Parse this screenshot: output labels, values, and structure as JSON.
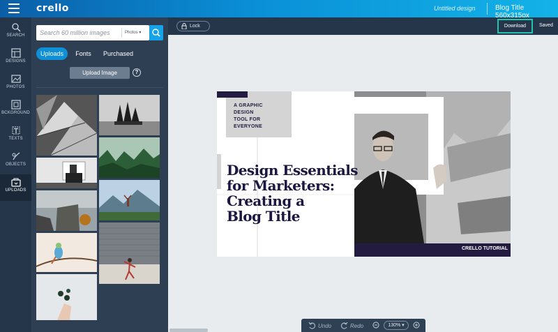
{
  "app": {
    "logo": "crello",
    "doc_title": "Untitled design",
    "format": "Blog Title 560x315px"
  },
  "rail": {
    "items": [
      {
        "label": "SEARCH",
        "icon": "search-icon"
      },
      {
        "label": "DESIGNS",
        "icon": "layout-icon"
      },
      {
        "label": "PHOTOS",
        "icon": "photo-icon"
      },
      {
        "label": "BCKGROUND",
        "icon": "background-icon"
      },
      {
        "label": "TEXTS",
        "icon": "text-icon"
      },
      {
        "label": "OBJECTS",
        "icon": "objects-icon"
      },
      {
        "label": "UPLOADS",
        "icon": "uploads-icon",
        "active": true
      }
    ]
  },
  "panel": {
    "search_placeholder": "Search 60 million images",
    "filter": "Photos",
    "tabs": [
      "Uploads",
      "Fonts",
      "Purchased"
    ],
    "active_tab": "Uploads",
    "upload_label": "Upload Image",
    "help": "?"
  },
  "toolbar": {
    "lock": "Lock",
    "download": "Download",
    "saved": "Saved"
  },
  "design": {
    "tagline": [
      "A GRAPHIC",
      "DESIGN",
      "TOOL FOR",
      "EVERYONE"
    ],
    "headline": [
      "Design Essentials",
      "for Marketers:",
      "Creating a",
      "Blog Title"
    ],
    "badge": "CRELLO TUTORIAL"
  },
  "zoom": {
    "undo": "Undo",
    "redo": "Redo",
    "level": "130%"
  },
  "colors": {
    "accent": "#17a3e8",
    "download_border": "#20c4b0",
    "rail_bg": "#25364a",
    "panel_bg": "#2e3f53",
    "headline": "#1c1740",
    "badge_bg": "#231c40"
  }
}
